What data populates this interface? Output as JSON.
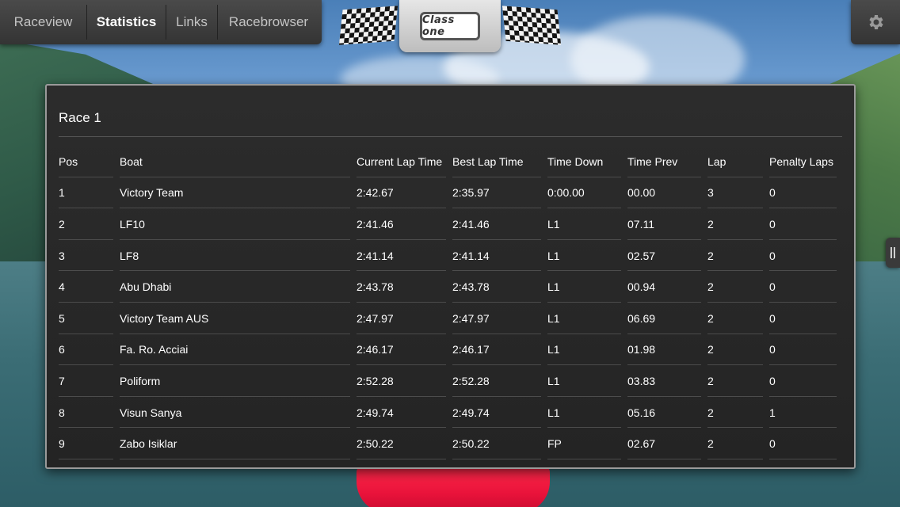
{
  "nav": {
    "items": [
      {
        "label": "Raceview",
        "active": false
      },
      {
        "label": "Statistics",
        "active": true
      },
      {
        "label": "Links",
        "active": false
      },
      {
        "label": "Racebrowser",
        "active": false
      }
    ]
  },
  "logo": {
    "text": "Class one",
    "icon": "class-one-logo"
  },
  "settings": {
    "icon": "gear-icon"
  },
  "side_handle": {
    "icon": "pause-handle-icon"
  },
  "race": {
    "title": "Race 1",
    "columns": [
      "Pos",
      "Boat",
      "Current Lap Time",
      "Best Lap Time",
      "Time Down",
      "Time Prev",
      "Lap",
      "Penalty Laps"
    ],
    "rows": [
      [
        "1",
        "Victory Team",
        "2:42.67",
        "2:35.97",
        "0:00.00",
        "00.00",
        "3",
        "0"
      ],
      [
        "2",
        "LF10",
        "2:41.46",
        "2:41.46",
        "L1",
        "07.11",
        "2",
        "0"
      ],
      [
        "3",
        "LF8",
        "2:41.14",
        "2:41.14",
        "L1",
        "02.57",
        "2",
        "0"
      ],
      [
        "4",
        "Abu Dhabi",
        "2:43.78",
        "2:43.78",
        "L1",
        "00.94",
        "2",
        "0"
      ],
      [
        "5",
        "Victory Team AUS",
        "2:47.97",
        "2:47.97",
        "L1",
        "06.69",
        "2",
        "0"
      ],
      [
        "6",
        "Fa. Ro. Acciai",
        "2:46.17",
        "2:46.17",
        "L1",
        "01.98",
        "2",
        "0"
      ],
      [
        "7",
        "Poliform",
        "2:52.28",
        "2:52.28",
        "L1",
        "03.83",
        "2",
        "0"
      ],
      [
        "8",
        "Visun Sanya",
        "2:49.74",
        "2:49.74",
        "L1",
        "05.16",
        "2",
        "1"
      ],
      [
        "9",
        "Zabo Isiklar",
        "2:50.22",
        "2:50.22",
        "FP",
        "02.67",
        "2",
        "0"
      ]
    ]
  },
  "colors": {
    "panel_bg": "#2a2a2a",
    "nav_bg": "#3c3c3c",
    "boat_red": "#e8123a"
  }
}
